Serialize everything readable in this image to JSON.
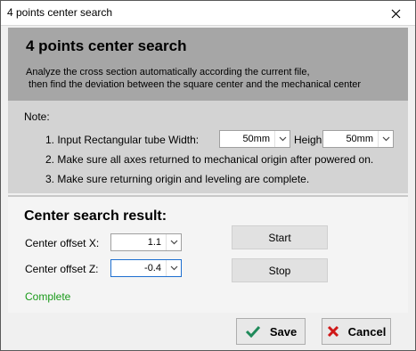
{
  "window": {
    "title": "4 points center search",
    "close_glyph": "✕"
  },
  "header": {
    "title": "4 points center search",
    "description": "Analyze the cross section automatically according the current file,\n then find the deviation between the square center and the mechanical center"
  },
  "notes": {
    "label": "Note:",
    "item1_prefix": "1. Input Rectangular tube Width:",
    "width_value": "50mm",
    "height_label": "Heigh",
    "height_value": "50mm",
    "item2": "2. Make sure all axes returned to mechanical origin after powered on.",
    "item3": "3. Make sure returning origin and leveling are complete."
  },
  "result": {
    "title": "Center search result:",
    "offset_x_label": "Center offset X:",
    "offset_x_value": "1.1",
    "offset_z_label": "Center offset Z:",
    "offset_z_value": "-0.4",
    "start_label": "Start",
    "stop_label": "Stop",
    "status": "Complete",
    "status_color": "#1a9a1a"
  },
  "footer": {
    "save_label": "Save",
    "cancel_label": "Cancel",
    "save_icon": "check-icon",
    "cancel_icon": "x-icon"
  }
}
